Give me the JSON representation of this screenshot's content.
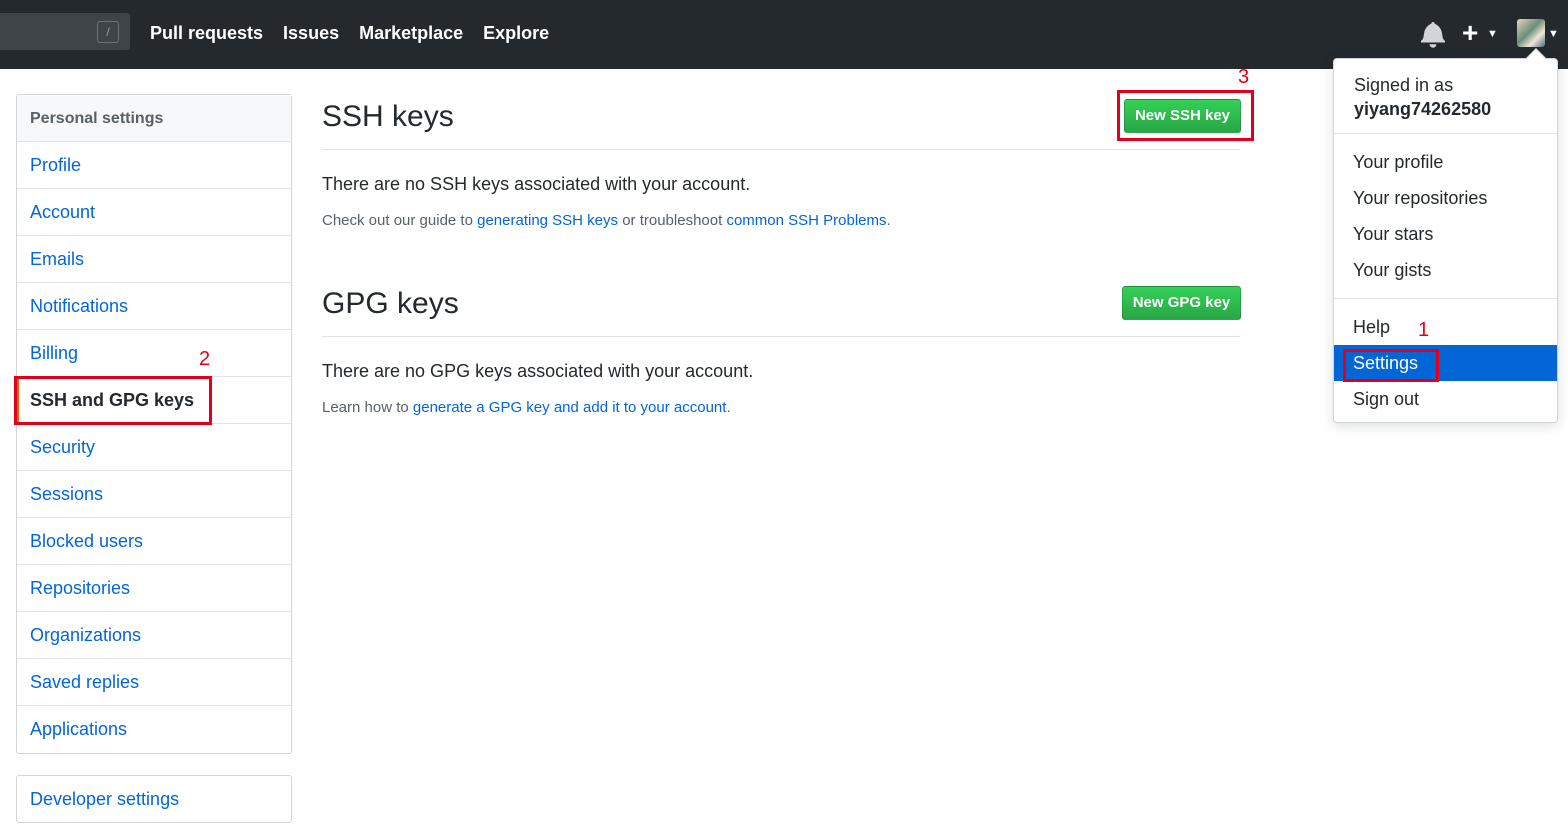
{
  "header": {
    "search_slash": "/",
    "nav": [
      "Pull requests",
      "Issues",
      "Marketplace",
      "Explore"
    ],
    "icons": [
      "bell-icon",
      "plus-icon",
      "avatar"
    ]
  },
  "sidebar": {
    "heading": "Personal settings",
    "items": [
      {
        "label": "Profile"
      },
      {
        "label": "Account"
      },
      {
        "label": "Emails"
      },
      {
        "label": "Notifications"
      },
      {
        "label": "Billing"
      },
      {
        "label": "SSH and GPG keys",
        "selected": true
      },
      {
        "label": "Security"
      },
      {
        "label": "Sessions"
      },
      {
        "label": "Blocked users"
      },
      {
        "label": "Repositories"
      },
      {
        "label": "Organizations"
      },
      {
        "label": "Saved replies"
      },
      {
        "label": "Applications"
      }
    ],
    "developer_settings": "Developer settings"
  },
  "ssh": {
    "title": "SSH keys",
    "button": "New SSH key",
    "empty": "There are no SSH keys associated with your account.",
    "note_prefix": "Check out our guide to ",
    "note_link1": "generating SSH keys",
    "note_middle": " or troubleshoot ",
    "note_link2": "common SSH Problems",
    "note_suffix": "."
  },
  "gpg": {
    "title": "GPG keys",
    "button": "New GPG key",
    "empty": "There are no GPG keys associated with your account.",
    "note_prefix": "Learn how to ",
    "note_link": "generate a GPG key and add it to your account",
    "note_suffix": "."
  },
  "dropdown": {
    "signed_in_as": "Signed in as",
    "username": "yiyang74262580",
    "items_group1": [
      "Your profile",
      "Your repositories",
      "Your stars",
      "Your gists"
    ],
    "help": "Help",
    "settings": "Settings",
    "sign_out": "Sign out"
  },
  "annotations": {
    "step1": "1",
    "step2": "2",
    "step3": "3",
    "color": "#e0001b"
  },
  "colors": {
    "header_bg": "#24292e",
    "link": "#0366d6",
    "button_green": "#28a745",
    "active_item": "#0366d6"
  }
}
